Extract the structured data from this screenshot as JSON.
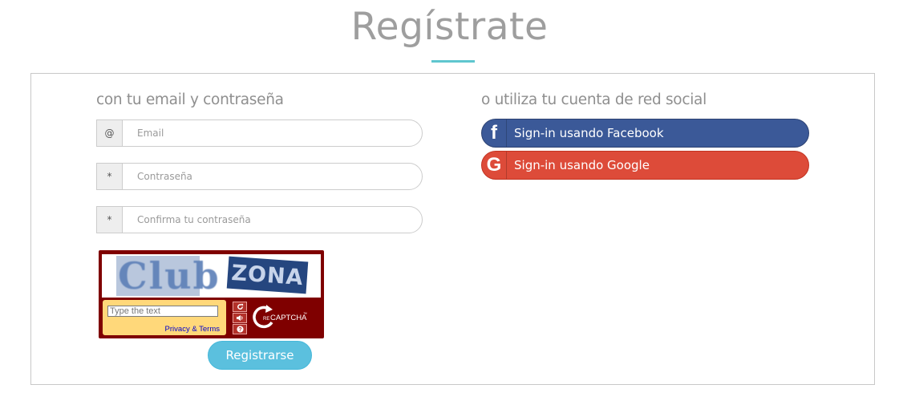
{
  "page": {
    "title": "Regístrate"
  },
  "email_section": {
    "heading": "con tu email y contraseña",
    "email": {
      "addon": "@",
      "placeholder": "Email",
      "value": ""
    },
    "password": {
      "addon": "*",
      "placeholder": "Contraseña",
      "value": ""
    },
    "confirm_password": {
      "addon": "*",
      "placeholder": "Confirma tu contraseña",
      "value": ""
    }
  },
  "captcha": {
    "word_1": "Club",
    "word_2": "ZONA",
    "input_placeholder": "Type the text",
    "links": "Privacy & Terms",
    "reload_icon": "reload-icon",
    "audio_icon": "speaker-icon",
    "help_icon": "help-icon",
    "logo_text": "CAPTCHA",
    "logo_prefix": "RE",
    "logo_tm": "™"
  },
  "submit": {
    "label": "Registrarse"
  },
  "social_section": {
    "heading": "o utiliza tu cuenta de red social",
    "facebook": {
      "icon": "f",
      "label": "Sign-in usando Facebook"
    },
    "google": {
      "icon": "G",
      "label": "Sign-in usando Google"
    }
  },
  "colors": {
    "accent": "#5fc6cf",
    "facebook": "#3b5998",
    "google": "#dd4b39",
    "submit": "#5bc0de",
    "captcha_frame": "#7f0000"
  }
}
